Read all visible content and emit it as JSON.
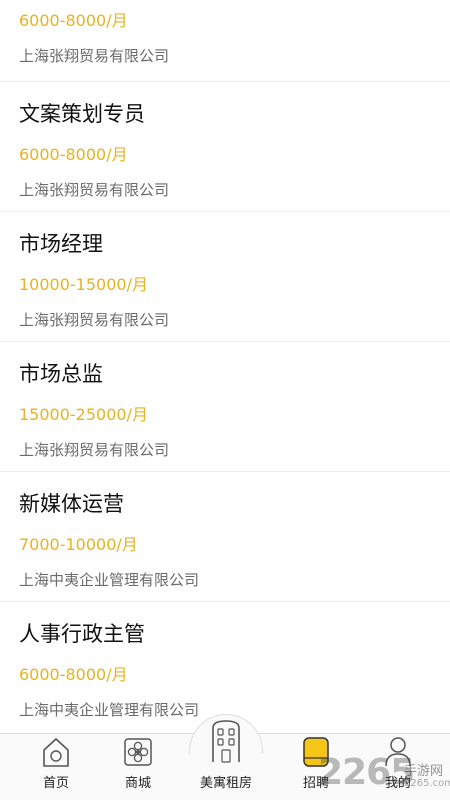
{
  "jobs": [
    {
      "title": "",
      "salary": "6000-8000/月",
      "company": "上海张翔贸易有限公司"
    },
    {
      "title": "文案策划专员",
      "salary": "6000-8000/月",
      "company": "上海张翔贸易有限公司"
    },
    {
      "title": "市场经理",
      "salary": "10000-15000/月",
      "company": "上海张翔贸易有限公司"
    },
    {
      "title": "市场总监",
      "salary": "15000-25000/月",
      "company": "上海张翔贸易有限公司"
    },
    {
      "title": "新媒体运营",
      "salary": "7000-10000/月",
      "company": "上海中夷企业管理有限公司"
    },
    {
      "title": "人事行政主管",
      "salary": "6000-8000/月",
      "company": "上海中夷企业管理有限公司"
    }
  ],
  "tabbar": {
    "tabs": [
      {
        "label": "首页",
        "icon": "home-icon"
      },
      {
        "label": "商城",
        "icon": "flower-icon"
      },
      {
        "label": "美寓租房",
        "icon": "apartment-icon"
      },
      {
        "label": "招聘",
        "icon": "recruit-icon",
        "active": true
      },
      {
        "label": "我的",
        "icon": "person-icon"
      }
    ],
    "active_color": "#f5c518"
  },
  "watermark": {
    "number": "2265",
    "text": "手游网",
    "url": "2265.com"
  },
  "colors": {
    "salary": "#e9b21f",
    "title": "#111111",
    "company": "#6b6b6b"
  }
}
